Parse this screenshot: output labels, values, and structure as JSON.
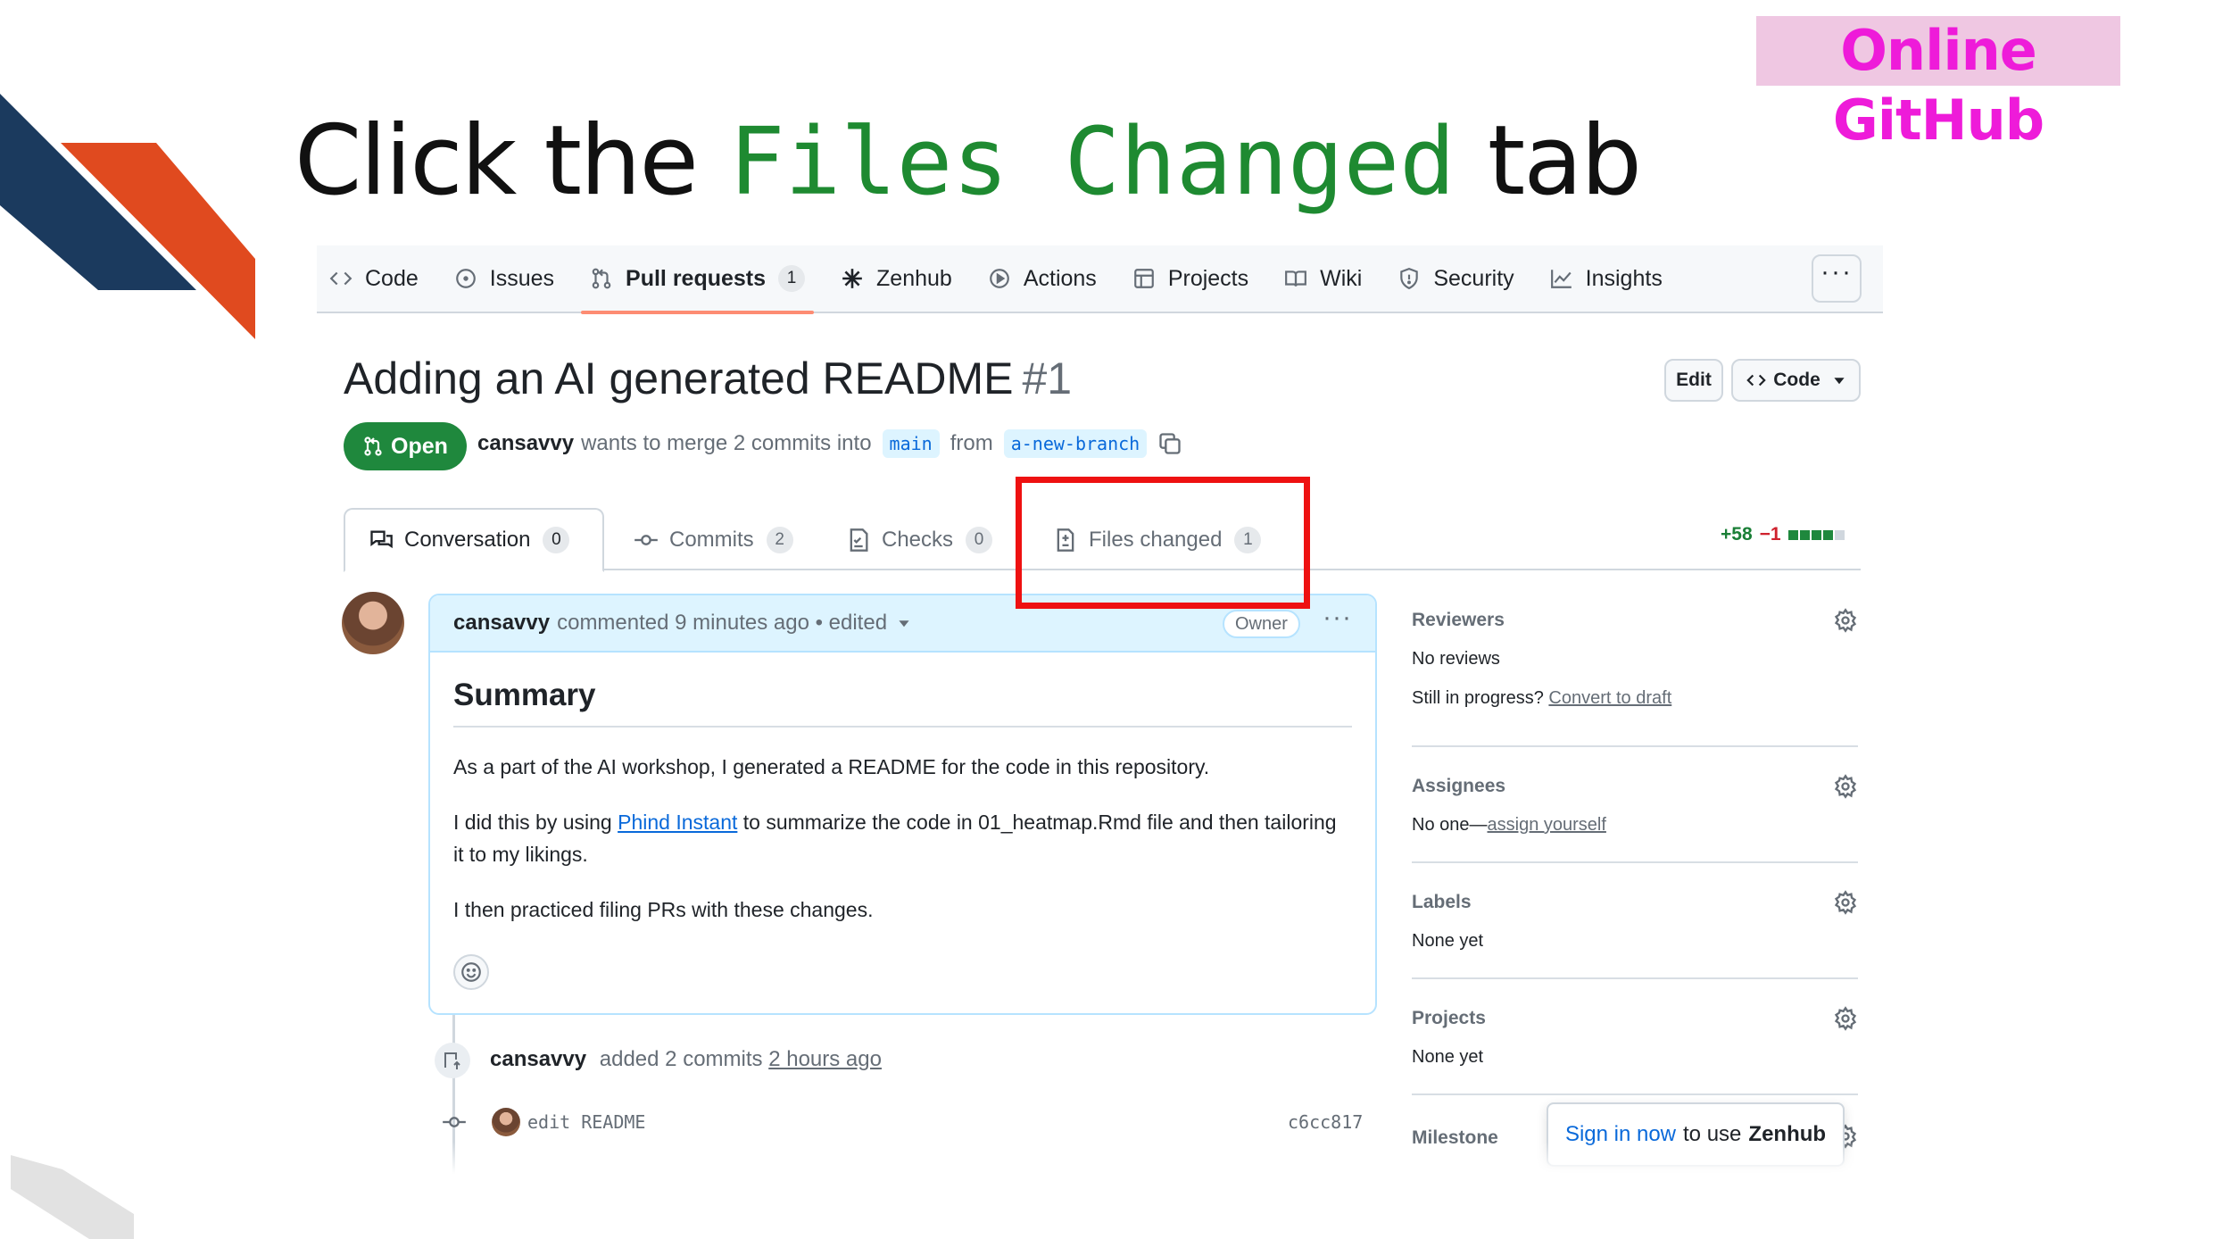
{
  "slide": {
    "badge": "Online GitHub",
    "title_pre": "Click the",
    "title_code": "Files Changed",
    "title_post": "tab",
    "colors": {
      "navy": "#1b3a5e",
      "orange": "#e04a1f",
      "green_code": "#1e8a31",
      "badge_text": "#ee1bd9",
      "badge_bg": "#efc7e2",
      "highlight": "#ee1111"
    }
  },
  "repo_nav": {
    "items": [
      {
        "label": "Code",
        "icon": "code-icon"
      },
      {
        "label": "Issues",
        "icon": "issue-icon"
      },
      {
        "label": "Pull requests",
        "icon": "pull-request-icon",
        "count": "1",
        "active": true
      },
      {
        "label": "Zenhub",
        "icon": "zenhub-icon"
      },
      {
        "label": "Actions",
        "icon": "play-icon"
      },
      {
        "label": "Projects",
        "icon": "table-icon"
      },
      {
        "label": "Wiki",
        "icon": "book-icon"
      },
      {
        "label": "Security",
        "icon": "shield-icon"
      },
      {
        "label": "Insights",
        "icon": "graph-icon"
      }
    ],
    "more": "···"
  },
  "pr": {
    "title": "Adding an AI generated README",
    "number": "#1",
    "edit_label": "Edit",
    "code_label": "Code",
    "status": "Open",
    "author": "cansavvy",
    "merge_text": "wants to merge 2 commits into",
    "base_branch": "main",
    "from_text": "from",
    "head_branch": "a-new-branch"
  },
  "tabs": [
    {
      "label": "Conversation",
      "count": "0",
      "icon": "comment-discussion-icon",
      "active": true
    },
    {
      "label": "Commits",
      "count": "2",
      "icon": "commit-icon"
    },
    {
      "label": "Checks",
      "count": "0",
      "icon": "checklist-icon"
    },
    {
      "label": "Files changed",
      "count": "1",
      "icon": "file-diff-icon"
    }
  ],
  "diffstat": {
    "additions": "+58",
    "deletions": "−1"
  },
  "comment": {
    "author": "cansavvy",
    "meta": "commented 9 minutes ago • edited",
    "badge": "Owner",
    "heading": "Summary",
    "p1": "As a part of the AI workshop, I generated a README for the code in this repository.",
    "p2_pre": "I did this by using",
    "p2_link": "Phind Instant",
    "p2_post": "to summarize the code in 01_heatmap.Rmd file and then tailoring it to my likings.",
    "p3": "I then practiced filing PRs with these changes."
  },
  "timeline": {
    "author": "cansavvy",
    "text": "added 2 commits",
    "time": "2 hours ago",
    "commit_msg": "edit README",
    "commit_sha": "c6cc817"
  },
  "sidebar": {
    "reviewers": {
      "title": "Reviewers",
      "line1": "No reviews",
      "line2_pre": "Still in progress?",
      "line2_link": "Convert to draft"
    },
    "assignees": {
      "title": "Assignees",
      "pre": "No one—",
      "link": "assign yourself"
    },
    "labels": {
      "title": "Labels",
      "value": "None yet"
    },
    "projects": {
      "title": "Projects",
      "value": "None yet"
    },
    "milestone": {
      "title": "Milestone"
    }
  },
  "zenhub_toast": {
    "sign_in": "Sign in now",
    "mid": "to use",
    "brand": "Zenhub"
  }
}
